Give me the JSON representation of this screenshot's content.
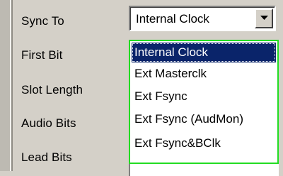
{
  "labels": {
    "sync_to": "Sync To",
    "first_bit": "First Bit",
    "slot_length": "Slot Length",
    "audio_bits": "Audio Bits",
    "lead_bits": "Lead Bits"
  },
  "sync_to_combo": {
    "value": "Internal Clock",
    "arrow_icon": "chevron-down-icon",
    "options": [
      "Internal Clock",
      "Ext Masterclk",
      "Ext Fsync",
      "Ext Fsync (AudMon)",
      "Ext Fsync&BClk"
    ],
    "selected_index": 0
  },
  "colors": {
    "selection": "#0a246a",
    "dropdown_border": "#22dd22",
    "panel": "#d4d0c8"
  }
}
